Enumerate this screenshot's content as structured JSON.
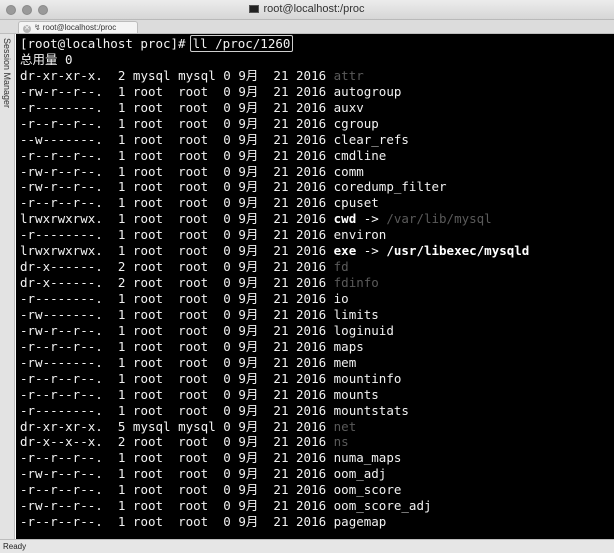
{
  "window": {
    "title": "root@localhost:/proc"
  },
  "tab": {
    "close_glyph": "✕",
    "icon_glyph": "↯",
    "label": "root@localhost:/proc"
  },
  "sidebar": {
    "label": "Session Manager"
  },
  "terminal": {
    "prompt": "[root@localhost proc]#",
    "command": "ll /proc/1260",
    "total_line": "总用量 0",
    "entries": [
      {
        "perms": "dr-xr-xr-x.",
        "links": "2",
        "owner": "mysql",
        "group": "mysql",
        "size": "0",
        "month": "9月",
        "day": "21",
        "year": "2016",
        "name": "attr",
        "kind": "dir"
      },
      {
        "perms": "-rw-r--r--.",
        "links": "1",
        "owner": "root",
        "group": "root",
        "size": "0",
        "month": "9月",
        "day": "21",
        "year": "2016",
        "name": "autogroup",
        "kind": "file"
      },
      {
        "perms": "-r--------.",
        "links": "1",
        "owner": "root",
        "group": "root",
        "size": "0",
        "month": "9月",
        "day": "21",
        "year": "2016",
        "name": "auxv",
        "kind": "file"
      },
      {
        "perms": "-r--r--r--.",
        "links": "1",
        "owner": "root",
        "group": "root",
        "size": "0",
        "month": "9月",
        "day": "21",
        "year": "2016",
        "name": "cgroup",
        "kind": "file"
      },
      {
        "perms": "--w-------.",
        "links": "1",
        "owner": "root",
        "group": "root",
        "size": "0",
        "month": "9月",
        "day": "21",
        "year": "2016",
        "name": "clear_refs",
        "kind": "file"
      },
      {
        "perms": "-r--r--r--.",
        "links": "1",
        "owner": "root",
        "group": "root",
        "size": "0",
        "month": "9月",
        "day": "21",
        "year": "2016",
        "name": "cmdline",
        "kind": "file"
      },
      {
        "perms": "-rw-r--r--.",
        "links": "1",
        "owner": "root",
        "group": "root",
        "size": "0",
        "month": "9月",
        "day": "21",
        "year": "2016",
        "name": "comm",
        "kind": "file"
      },
      {
        "perms": "-rw-r--r--.",
        "links": "1",
        "owner": "root",
        "group": "root",
        "size": "0",
        "month": "9月",
        "day": "21",
        "year": "2016",
        "name": "coredump_filter",
        "kind": "file"
      },
      {
        "perms": "-r--r--r--.",
        "links": "1",
        "owner": "root",
        "group": "root",
        "size": "0",
        "month": "9月",
        "day": "21",
        "year": "2016",
        "name": "cpuset",
        "kind": "file"
      },
      {
        "perms": "lrwxrwxrwx.",
        "links": "1",
        "owner": "root",
        "group": "root",
        "size": "0",
        "month": "9月",
        "day": "21",
        "year": "2016",
        "name": "cwd",
        "kind": "link",
        "target": "/var/lib/mysql",
        "target_style": "dim"
      },
      {
        "perms": "-r--------.",
        "links": "1",
        "owner": "root",
        "group": "root",
        "size": "0",
        "month": "9月",
        "day": "21",
        "year": "2016",
        "name": "environ",
        "kind": "file"
      },
      {
        "perms": "lrwxrwxrwx.",
        "links": "1",
        "owner": "root",
        "group": "root",
        "size": "0",
        "month": "9月",
        "day": "21",
        "year": "2016",
        "name": "exe",
        "kind": "link",
        "target": "/usr/libexec/mysqld",
        "target_style": "bold"
      },
      {
        "perms": "dr-x------.",
        "links": "2",
        "owner": "root",
        "group": "root",
        "size": "0",
        "month": "9月",
        "day": "21",
        "year": "2016",
        "name": "fd",
        "kind": "dir"
      },
      {
        "perms": "dr-x------.",
        "links": "2",
        "owner": "root",
        "group": "root",
        "size": "0",
        "month": "9月",
        "day": "21",
        "year": "2016",
        "name": "fdinfo",
        "kind": "dir"
      },
      {
        "perms": "-r--------.",
        "links": "1",
        "owner": "root",
        "group": "root",
        "size": "0",
        "month": "9月",
        "day": "21",
        "year": "2016",
        "name": "io",
        "kind": "file"
      },
      {
        "perms": "-rw-------.",
        "links": "1",
        "owner": "root",
        "group": "root",
        "size": "0",
        "month": "9月",
        "day": "21",
        "year": "2016",
        "name": "limits",
        "kind": "file"
      },
      {
        "perms": "-rw-r--r--.",
        "links": "1",
        "owner": "root",
        "group": "root",
        "size": "0",
        "month": "9月",
        "day": "21",
        "year": "2016",
        "name": "loginuid",
        "kind": "file"
      },
      {
        "perms": "-r--r--r--.",
        "links": "1",
        "owner": "root",
        "group": "root",
        "size": "0",
        "month": "9月",
        "day": "21",
        "year": "2016",
        "name": "maps",
        "kind": "file"
      },
      {
        "perms": "-rw-------.",
        "links": "1",
        "owner": "root",
        "group": "root",
        "size": "0",
        "month": "9月",
        "day": "21",
        "year": "2016",
        "name": "mem",
        "kind": "file"
      },
      {
        "perms": "-r--r--r--.",
        "links": "1",
        "owner": "root",
        "group": "root",
        "size": "0",
        "month": "9月",
        "day": "21",
        "year": "2016",
        "name": "mountinfo",
        "kind": "file"
      },
      {
        "perms": "-r--r--r--.",
        "links": "1",
        "owner": "root",
        "group": "root",
        "size": "0",
        "month": "9月",
        "day": "21",
        "year": "2016",
        "name": "mounts",
        "kind": "file"
      },
      {
        "perms": "-r--------.",
        "links": "1",
        "owner": "root",
        "group": "root",
        "size": "0",
        "month": "9月",
        "day": "21",
        "year": "2016",
        "name": "mountstats",
        "kind": "file"
      },
      {
        "perms": "dr-xr-xr-x.",
        "links": "5",
        "owner": "mysql",
        "group": "mysql",
        "size": "0",
        "month": "9月",
        "day": "21",
        "year": "2016",
        "name": "net",
        "kind": "dir"
      },
      {
        "perms": "dr-x--x--x.",
        "links": "2",
        "owner": "root",
        "group": "root",
        "size": "0",
        "month": "9月",
        "day": "21",
        "year": "2016",
        "name": "ns",
        "kind": "dir"
      },
      {
        "perms": "-r--r--r--.",
        "links": "1",
        "owner": "root",
        "group": "root",
        "size": "0",
        "month": "9月",
        "day": "21",
        "year": "2016",
        "name": "numa_maps",
        "kind": "file"
      },
      {
        "perms": "-rw-r--r--.",
        "links": "1",
        "owner": "root",
        "group": "root",
        "size": "0",
        "month": "9月",
        "day": "21",
        "year": "2016",
        "name": "oom_adj",
        "kind": "file"
      },
      {
        "perms": "-r--r--r--.",
        "links": "1",
        "owner": "root",
        "group": "root",
        "size": "0",
        "month": "9月",
        "day": "21",
        "year": "2016",
        "name": "oom_score",
        "kind": "file"
      },
      {
        "perms": "-rw-r--r--.",
        "links": "1",
        "owner": "root",
        "group": "root",
        "size": "0",
        "month": "9月",
        "day": "21",
        "year": "2016",
        "name": "oom_score_adj",
        "kind": "file"
      },
      {
        "perms": "-r--r--r--.",
        "links": "1",
        "owner": "root",
        "group": "root",
        "size": "0",
        "month": "9月",
        "day": "21",
        "year": "2016",
        "name": "pagemap",
        "kind": "file"
      }
    ]
  },
  "statusbar": {
    "text": "Ready"
  },
  "colors": {
    "terminal_bg": "#000000",
    "terminal_fg": "#f2f2f2",
    "dir_color": "#5a5a5a"
  }
}
